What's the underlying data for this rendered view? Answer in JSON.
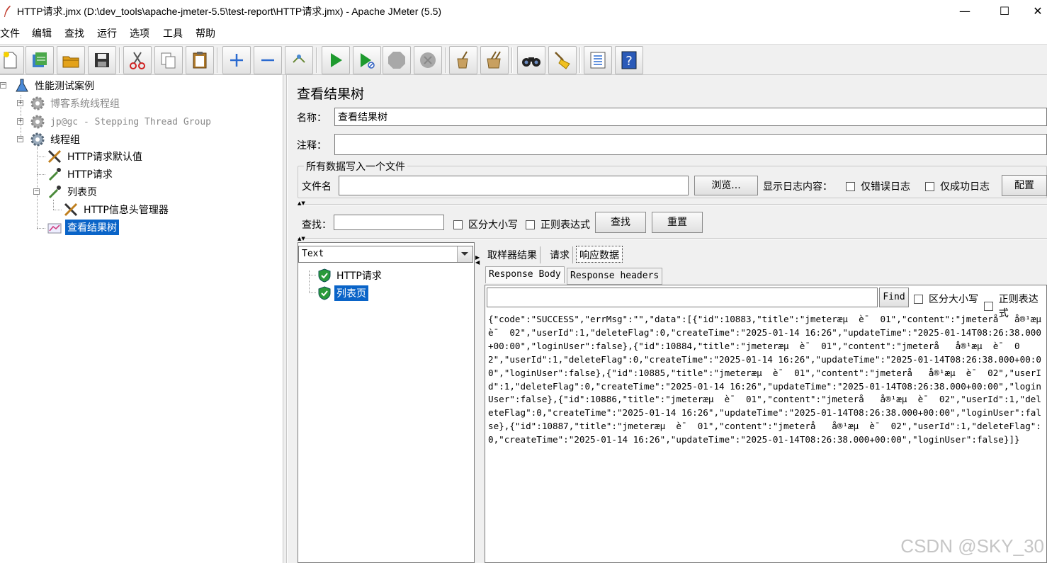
{
  "window": {
    "title": "HTTP请求.jmx (D:\\dev_tools\\apache-jmeter-5.5\\test-report\\HTTP请求.jmx) - Apache JMeter (5.5)",
    "minimize": "—",
    "maximize": "☐",
    "close": "✕"
  },
  "menu": [
    "文件",
    "编辑",
    "查找",
    "运行",
    "选项",
    "工具",
    "帮助"
  ],
  "toolbar": [
    {
      "name": "new-icon"
    },
    {
      "name": "templates-icon"
    },
    {
      "name": "open-icon"
    },
    {
      "name": "save-icon"
    },
    {
      "name": "cut-icon"
    },
    {
      "name": "copy-icon"
    },
    {
      "name": "paste-icon"
    },
    {
      "name": "expand-all-icon"
    },
    {
      "name": "collapse-all-icon"
    },
    {
      "name": "toggle-icon"
    },
    {
      "name": "start-icon"
    },
    {
      "name": "start-no-pause-icon"
    },
    {
      "name": "stop-icon"
    },
    {
      "name": "shutdown-icon"
    },
    {
      "name": "clear-icon"
    },
    {
      "name": "clear-all-icon"
    },
    {
      "name": "search-icon"
    },
    {
      "name": "reset-search-icon"
    },
    {
      "name": "function-helper-icon"
    },
    {
      "name": "help-icon"
    }
  ],
  "tree": [
    {
      "label": "性能测试案例",
      "icon": "test-plan-icon"
    },
    {
      "label": "博客系统线程组",
      "icon": "thread-group-icon"
    },
    {
      "label": "jp@gc - Stepping Thread Group",
      "icon": "thread-group-icon"
    },
    {
      "label": "线程组",
      "icon": "thread-group-icon"
    },
    {
      "label": "HTTP请求默认值",
      "icon": "config-element-icon"
    },
    {
      "label": "HTTP请求",
      "icon": "sampler-icon"
    },
    {
      "label": "列表页",
      "icon": "sampler-icon"
    },
    {
      "label": "HTTP信息头管理器",
      "icon": "config-element-icon"
    },
    {
      "label": "查看结果树",
      "icon": "listener-icon"
    }
  ],
  "panel": {
    "title": "查看结果树",
    "name_label": "名称：",
    "name_value": "查看结果树",
    "comment_label": "注释：",
    "comment_value": "",
    "file_group_legend": "所有数据写入一个文件",
    "filename_label": "文件名",
    "filename_value": "",
    "browse_button": "浏览...",
    "log_display_label": "显示日志内容：",
    "errors_only": "仅错误日志",
    "success_only": "仅成功日志",
    "configure_button": "配置",
    "search_label": "查找：",
    "search_value": "",
    "case_sensitive": "区分大小写",
    "regex": "正则表达式",
    "search_button": "查找",
    "reset_button": "重置"
  },
  "results": {
    "renderer": "Text",
    "samples": [
      {
        "label": "HTTP请求",
        "status": "success-icon"
      },
      {
        "label": "列表页",
        "status": "success-icon"
      }
    ],
    "tabs": [
      "取样器结果",
      "请求",
      "响应数据"
    ],
    "active_tab": "响应数据",
    "sub_tabs": [
      "Response Body",
      "Response headers"
    ],
    "active_sub_tab": "Response Body",
    "find_value": "",
    "find_button": "Find",
    "find_case": "区分大小写",
    "find_regex": "正则表达式",
    "response_body": "{\"code\":\"SUCCESS\",\"errMsg\":\"\",\"data\":[{\"id\":10883,\"title\":\"jmeteræµ  è¯  01\",\"content\":\"jmeterå   å®¹æµ  è¯  02\",\"userId\":1,\"deleteFlag\":0,\"createTime\":\"2025-01-14 16:26\",\"updateTime\":\"2025-01-14T08:26:38.000+00:00\",\"loginUser\":false},{\"id\":10884,\"title\":\"jmeteræµ  è¯  01\",\"content\":\"jmeterå   å®¹æµ  è¯  02\",\"userId\":1,\"deleteFlag\":0,\"createTime\":\"2025-01-14 16:26\",\"updateTime\":\"2025-01-14T08:26:38.000+00:00\",\"loginUser\":false},{\"id\":10885,\"title\":\"jmeteræµ  è¯  01\",\"content\":\"jmeterå   å®¹æµ  è¯  02\",\"userId\":1,\"deleteFlag\":0,\"createTime\":\"2025-01-14 16:26\",\"updateTime\":\"2025-01-14T08:26:38.000+00:00\",\"loginUser\":false},{\"id\":10886,\"title\":\"jmeteræµ  è¯  01\",\"content\":\"jmeterå   å®¹æµ  è¯  02\",\"userId\":1,\"deleteFlag\":0,\"createTime\":\"2025-01-14 16:26\",\"updateTime\":\"2025-01-14T08:26:38.000+00:00\",\"loginUser\":false},{\"id\":10887,\"title\":\"jmeteræµ  è¯  01\",\"content\":\"jmeterå   å®¹æµ  è¯  02\",\"userId\":1,\"deleteFlag\":0,\"createTime\":\"2025-01-14 16:26\",\"updateTime\":\"2025-01-14T08:26:38.000+00:00\",\"loginUser\":false}]}"
  },
  "watermark": "CSDN @SKY_30"
}
